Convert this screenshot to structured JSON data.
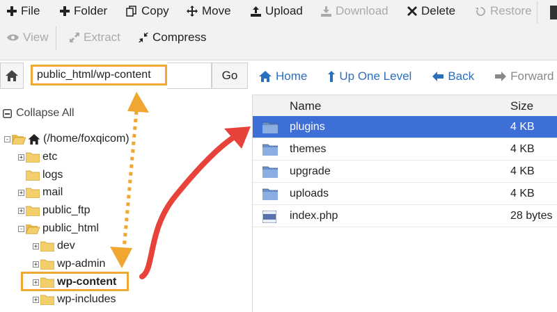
{
  "toolbar": {
    "row1": [
      {
        "label": "File",
        "icon": "plus-icon",
        "enabled": true
      },
      {
        "label": "Folder",
        "icon": "plus-icon",
        "enabled": true
      },
      {
        "label": "Copy",
        "icon": "copy-icon",
        "enabled": true
      },
      {
        "label": "Move",
        "icon": "move-arrows-icon",
        "enabled": true
      },
      {
        "label": "Upload",
        "icon": "upload-icon",
        "enabled": true
      },
      {
        "label": "Download",
        "icon": "download-icon",
        "enabled": false
      },
      {
        "label": "Delete",
        "icon": "close-icon",
        "enabled": true
      },
      {
        "label": "Restore",
        "icon": "restore-icon",
        "enabled": false
      }
    ],
    "row2": [
      {
        "label": "View",
        "icon": "eye-icon",
        "enabled": false
      },
      {
        "label": "Extract",
        "icon": "expand-icon",
        "enabled": false
      },
      {
        "label": "Compress",
        "icon": "compress-icon",
        "enabled": true
      }
    ]
  },
  "path_bar": {
    "value": "public_html/wp-content",
    "go_label": "Go"
  },
  "nav": {
    "home": "Home",
    "up": "Up One Level",
    "back": "Back",
    "forward": "Forward"
  },
  "tree": {
    "collapse_all": "Collapse All",
    "root": "(/home/foxqicom)",
    "items": [
      {
        "label": "etc",
        "expander": "+"
      },
      {
        "label": "logs",
        "expander": ""
      },
      {
        "label": "mail",
        "expander": "+"
      },
      {
        "label": "public_ftp",
        "expander": "+"
      },
      {
        "label": "public_html",
        "expander": "-"
      },
      {
        "label": "dev",
        "expander": "+"
      },
      {
        "label": "wp-admin",
        "expander": "+"
      },
      {
        "label": "wp-content",
        "expander": "+",
        "current": true
      },
      {
        "label": "wp-includes",
        "expander": "+"
      }
    ]
  },
  "listing": {
    "columns": {
      "name": "Name",
      "size": "Size"
    },
    "rows": [
      {
        "name": "plugins",
        "size": "4 KB",
        "type": "folder",
        "selected": true
      },
      {
        "name": "themes",
        "size": "4 KB",
        "type": "folder",
        "selected": false
      },
      {
        "name": "upgrade",
        "size": "4 KB",
        "type": "folder",
        "selected": false
      },
      {
        "name": "uploads",
        "size": "4 KB",
        "type": "folder",
        "selected": false
      },
      {
        "name": "index.php",
        "size": "28 bytes",
        "type": "php",
        "selected": false
      }
    ]
  },
  "colors": {
    "accent": "#2a6fbe",
    "selected_row": "#3d6fd6",
    "highlight_box": "#f0a732",
    "annotation_arrow": "#e8433a"
  }
}
